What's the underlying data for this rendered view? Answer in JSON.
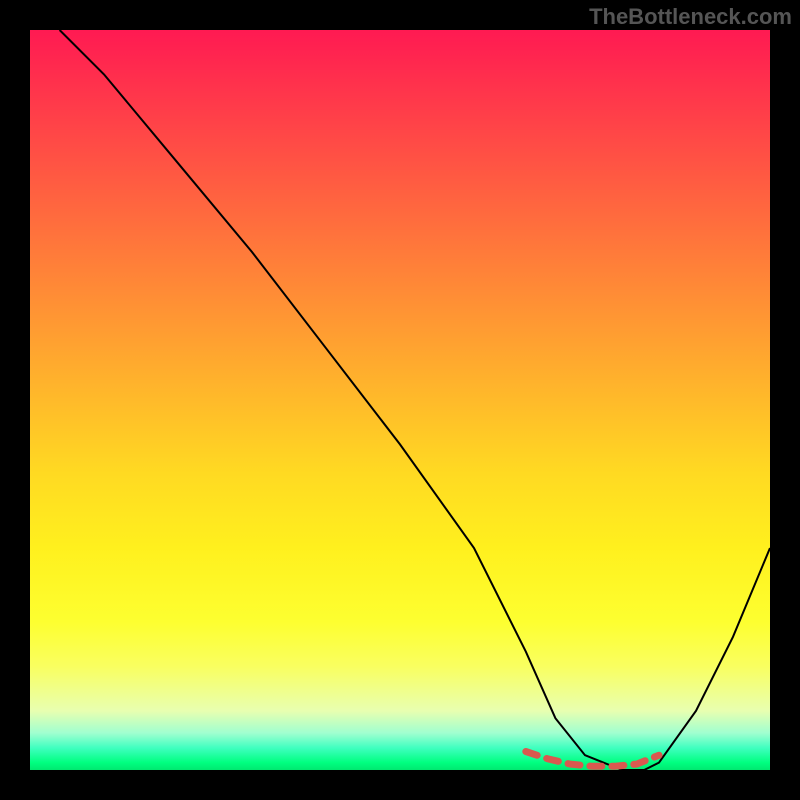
{
  "watermark": "TheBottleneck.com",
  "chart_data": {
    "type": "line",
    "title": "",
    "xlabel": "",
    "ylabel": "",
    "xlim": [
      0,
      100
    ],
    "ylim": [
      0,
      100
    ],
    "series": [
      {
        "name": "main-curve",
        "x": [
          4,
          10,
          20,
          30,
          40,
          50,
          60,
          67,
          71,
          75,
          80,
          83,
          85,
          90,
          95,
          100
        ],
        "y": [
          100,
          94,
          82,
          70,
          57,
          44,
          30,
          16,
          7,
          2,
          0,
          0,
          1,
          8,
          18,
          30
        ],
        "stroke": "#000000",
        "dashed_segment": null
      },
      {
        "name": "highlight-dashed",
        "x": [
          67,
          70,
          73,
          76,
          79,
          82,
          85
        ],
        "y": [
          2.5,
          1.5,
          0.8,
          0.5,
          0.5,
          0.8,
          2.0
        ],
        "stroke": "#d9594f",
        "dashed_segment": true
      }
    ],
    "gradient_stops": [
      {
        "pos": 0,
        "color": "#ff1a52"
      },
      {
        "pos": 50,
        "color": "#ffba2a"
      },
      {
        "pos": 85,
        "color": "#fdff30"
      },
      {
        "pos": 100,
        "color": "#00e870"
      }
    ]
  }
}
